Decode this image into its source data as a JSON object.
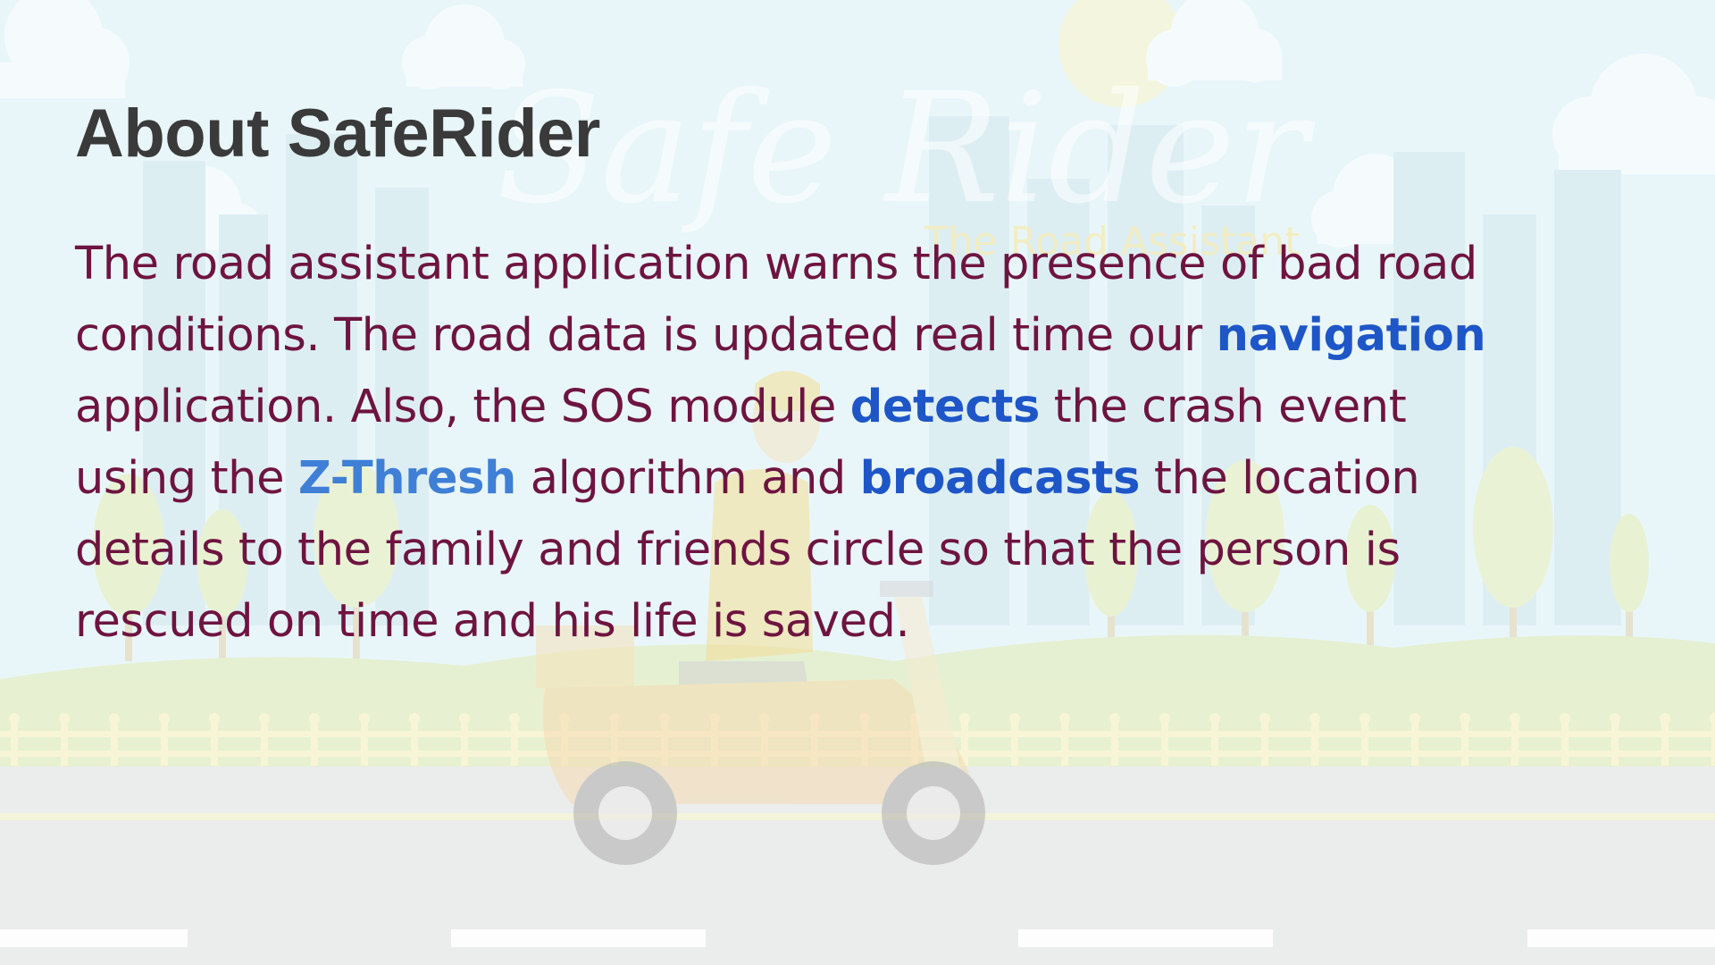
{
  "slide": {
    "title": "About SafeRider",
    "background_logo": {
      "wordmark": "Safe Rider",
      "tagline": "The Road Assistant"
    },
    "paragraph": {
      "lines": [
        [
          {
            "text": "The road assistant application warns the presence of bad road",
            "style": "normal"
          }
        ],
        [
          {
            "text": "conditions. The road data is updated real time our ",
            "style": "normal"
          },
          {
            "text": "navigation",
            "style": "highlight"
          }
        ],
        [
          {
            "text": "application. Also, the SOS module ",
            "style": "normal"
          },
          {
            "text": "detects",
            "style": "highlight"
          },
          {
            "text": " the crash event",
            "style": "normal"
          }
        ],
        [
          {
            "text": "using the ",
            "style": "normal"
          },
          {
            "text": "Z-Thresh",
            "style": "highlight-light"
          },
          {
            "text": " algorithm and ",
            "style": "normal"
          },
          {
            "text": "broadcasts",
            "style": "highlight"
          },
          {
            "text": " the location",
            "style": "normal"
          }
        ],
        [
          {
            "text": "details to the family and friends circle so that the person is",
            "style": "normal"
          }
        ],
        [
          {
            "text": "rescued on time and his life is saved.",
            "style": "normal"
          }
        ]
      ]
    }
  },
  "colors": {
    "title": "#3a3a3a",
    "body_text": "#6e1440",
    "highlight": "#1e56c8",
    "highlight_light": "#3f7fd6",
    "sky": "#e4f4f8",
    "road": "#e7e8e8"
  }
}
